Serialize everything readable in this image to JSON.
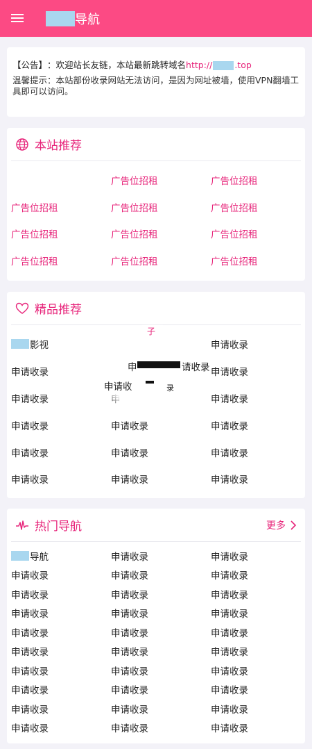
{
  "header": {
    "title": "导航",
    "bg_color": "#fc4a84",
    "menu_icon": "menu-icon"
  },
  "notice": {
    "label": "【公告】",
    "text": "：欢迎站长友链，本站最新跳转域名",
    "link_prefix": "http://",
    "link_suffix": ".top",
    "tip": "温馨提示：本站部份收录网站无法访问，是因为网址被墙，使用VPN翻墙工具即可以访问。"
  },
  "recommend": {
    "title": "本站推荐",
    "icon": "globe-icon",
    "items": [
      "",
      "广告位招租",
      "广告位招租",
      "广告位招租",
      "广告位招租",
      "广告位招租",
      "广告位招租",
      "广告位招租",
      "广告位招租",
      "广告位招租",
      "广告位招租",
      "广告位招租"
    ]
  },
  "featured": {
    "title": "精品推荐",
    "icon": "heart-icon",
    "first_item": "影视",
    "items": [
      "",
      "",
      "申请收录",
      "申请收录",
      "",
      "申请收录",
      "申请收录",
      "申",
      "申请收录",
      "申请收录",
      "申请收录",
      "申请收录",
      "申请收录",
      "申请收录",
      "申请收录",
      "申请收录",
      "申请收录",
      "申请收录"
    ],
    "overlay_texts": {
      "zi": "子",
      "apply_partial": "申",
      "apply_tail": "请收录",
      "apply_short": "申请收",
      "lu": "录"
    }
  },
  "hot": {
    "title": "热门导航",
    "icon": "pulse-icon",
    "more_label": "更多",
    "first_item": "导航",
    "items": [
      "",
      "申请收录",
      "申请收录",
      "申请收录",
      "申请收录",
      "申请收录",
      "申请收录",
      "申请收录",
      "申请收录",
      "申请收录",
      "申请收录",
      "申请收录",
      "申请收录",
      "申请收录",
      "申请收录",
      "申请收录",
      "申请收录",
      "申请收录",
      "申请收录",
      "申请收录",
      "申请收录",
      "申请收录",
      "申请收录",
      "申请收录",
      "申请收录",
      "申请收录",
      "申请收录",
      "申请收录",
      "申请收录",
      "申请收录"
    ]
  },
  "colors": {
    "accent": "#e7247a",
    "masked": "#a9d7ef",
    "page_bg": "#f3f2f8"
  }
}
